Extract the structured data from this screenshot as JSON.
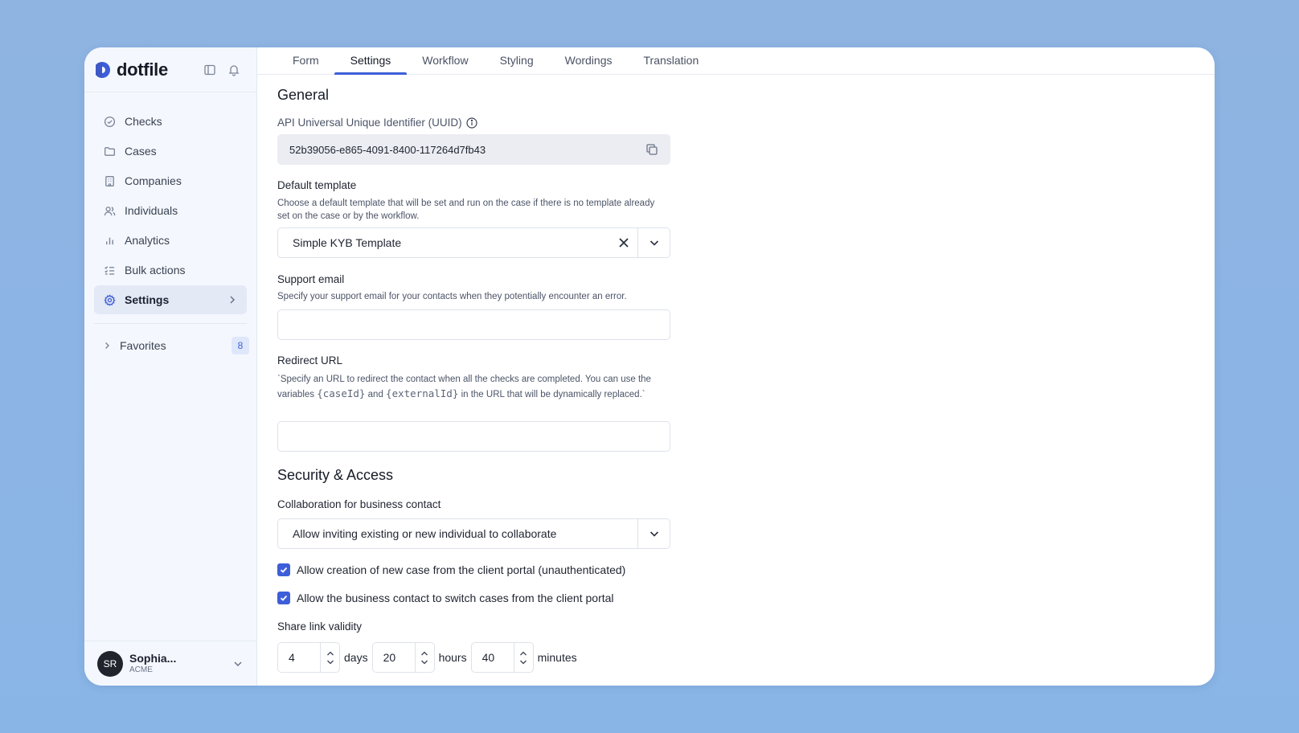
{
  "brand": {
    "name": "dotfile"
  },
  "sidebar": {
    "items": [
      {
        "label": "Checks",
        "icon": "check-circle-icon"
      },
      {
        "label": "Cases",
        "icon": "folder-icon"
      },
      {
        "label": "Companies",
        "icon": "building-icon"
      },
      {
        "label": "Individuals",
        "icon": "users-icon"
      },
      {
        "label": "Analytics",
        "icon": "bar-chart-icon"
      },
      {
        "label": "Bulk actions",
        "icon": "list-checks-icon"
      },
      {
        "label": "Settings",
        "icon": "gear-icon",
        "active": true
      }
    ],
    "favorites": {
      "label": "Favorites",
      "count": "8"
    },
    "user": {
      "initials": "SR",
      "name": "Sophia...",
      "org": "ACME"
    }
  },
  "tabs": [
    {
      "label": "Form"
    },
    {
      "label": "Settings",
      "active": true
    },
    {
      "label": "Workflow"
    },
    {
      "label": "Styling"
    },
    {
      "label": "Wordings"
    },
    {
      "label": "Translation"
    }
  ],
  "general": {
    "title": "General",
    "uuid_label": "API Universal Unique Identifier (UUID)",
    "uuid_value": "52b39056-e865-4091-8400-117264d7fb43",
    "default_template_label": "Default template",
    "default_template_desc": "Choose a default template that will be set and run on the case if there is no template already set on the case or by the workflow.",
    "default_template_value": "Simple KYB Template",
    "support_email_label": "Support email",
    "support_email_desc": "Specify your support email for your contacts when they potentially encounter an error.",
    "support_email_value": "",
    "redirect_label": "Redirect URL",
    "redirect_desc_1": "`Specify an URL to redirect the contact when all the checks are completed. You can use the variables",
    "redirect_var_1": "{caseId}",
    "redirect_and": "and",
    "redirect_var_2": "{externalId}",
    "redirect_desc_2": "in the URL that will be dynamically replaced.`",
    "redirect_value": ""
  },
  "security": {
    "title": "Security & Access",
    "collab_label": "Collaboration for business contact",
    "collab_value": "Allow inviting existing or new individual to collaborate",
    "checkbox_1": "Allow creation of new case from the client portal (unauthenticated)",
    "checkbox_2": "Allow the business contact to switch cases from the client portal",
    "share_label": "Share link validity",
    "days_value": "4",
    "days_unit": "days",
    "hours_value": "20",
    "hours_unit": "hours",
    "minutes_value": "40",
    "minutes_unit": "minutes"
  },
  "colors": {
    "accent": "#3d5ed8",
    "background": "#8fb4e2"
  }
}
